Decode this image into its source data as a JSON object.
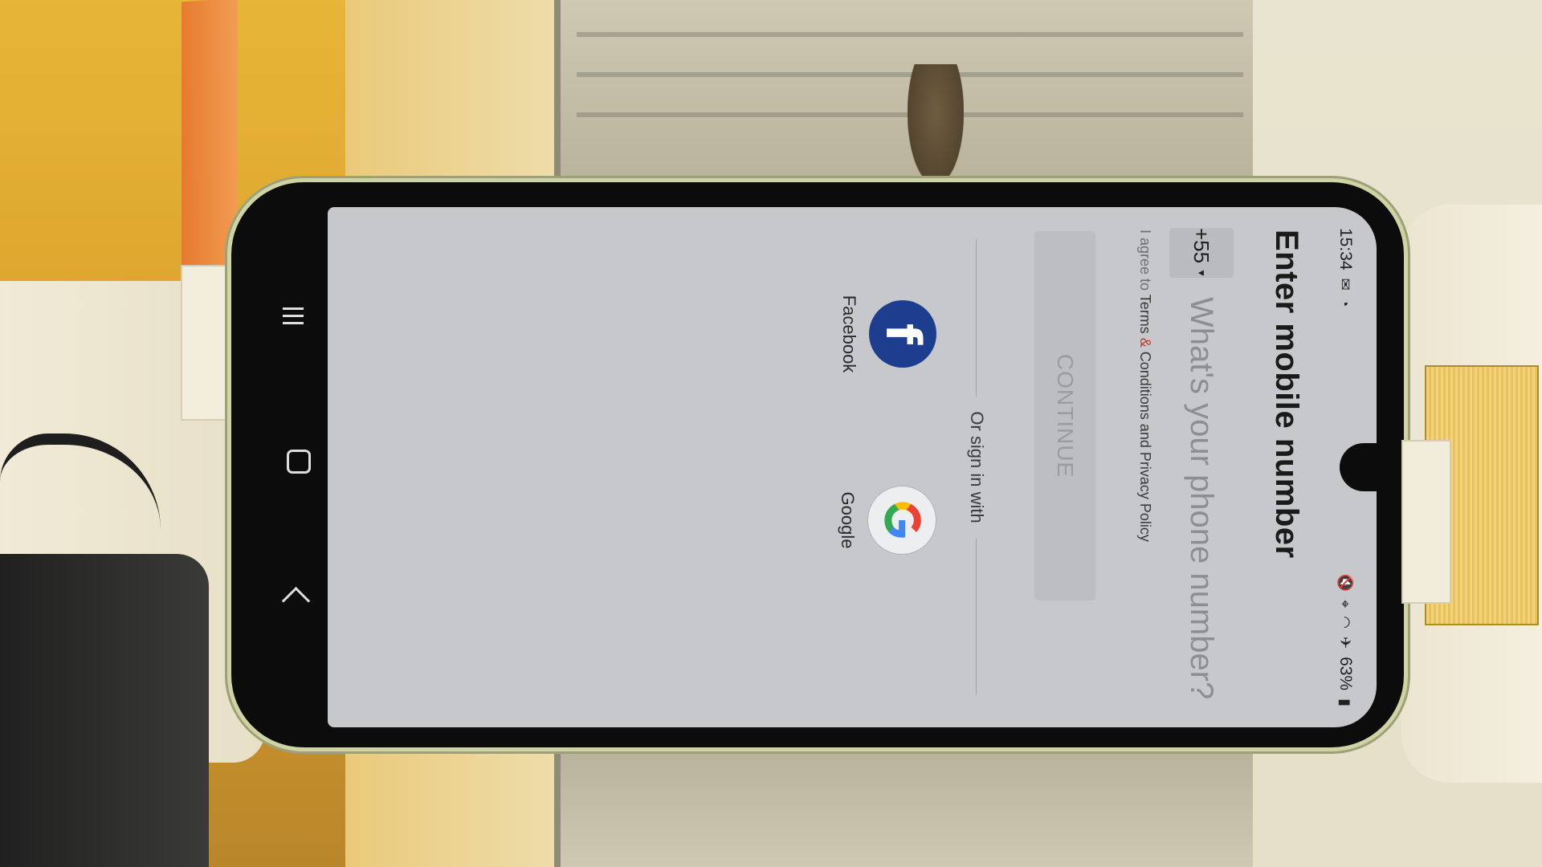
{
  "status_bar": {
    "time": "15:34",
    "battery": "63%",
    "left_icons": [
      "mail-icon",
      "sync-icon"
    ],
    "right_icons": [
      "mute-icon",
      "location-icon",
      "wifi-icon",
      "airplane-icon",
      "battery-icon"
    ]
  },
  "screen": {
    "title": "Enter mobile number",
    "country_code": "+55",
    "phone_placeholder": "What's your phone number?",
    "terms_prefix": "I agree to ",
    "terms_link_1": "Terms",
    "terms_amp": " & ",
    "terms_link_2": "Conditions and Privacy Policy",
    "continue_label": "CONTINUE",
    "divider_text": "Or sign in with",
    "social": [
      {
        "label": "Facebook",
        "icon": "facebook-icon",
        "glyph": "f"
      },
      {
        "label": "Google",
        "icon": "google-icon"
      }
    ]
  },
  "nav_bar": {
    "buttons": [
      "recents-icon",
      "home-icon",
      "back-icon"
    ]
  },
  "colors": {
    "facebook_blue": "#1d3e8f",
    "screen_bg": "#c6c8cb",
    "terms_red": "#c0392b"
  }
}
